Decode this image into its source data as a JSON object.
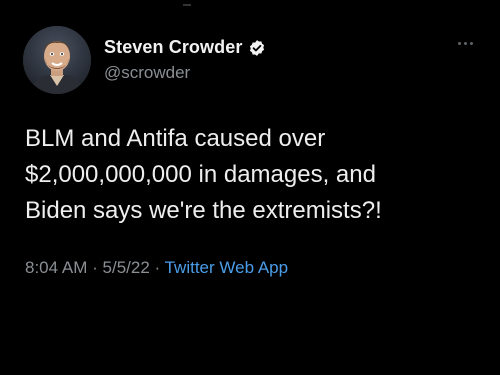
{
  "tweet": {
    "author": {
      "display_name": "Steven Crowder",
      "handle": "@scrowder",
      "verified": true,
      "avatar_icon": "profile-photo"
    },
    "text": "BLM and Antifa caused over\n$2,000,000,000 in damages, and\nBiden says we're the extremists?!",
    "time": "8:04 AM",
    "separator": "·",
    "date": "5/5/22",
    "source": "Twitter Web App",
    "more_icon": "more-horizontal-icon"
  },
  "colors": {
    "background": "#000000",
    "text": "#eeeeee",
    "secondary": "#8a8f94",
    "link": "#4a9de8",
    "verified_badge": "#ffffff"
  }
}
